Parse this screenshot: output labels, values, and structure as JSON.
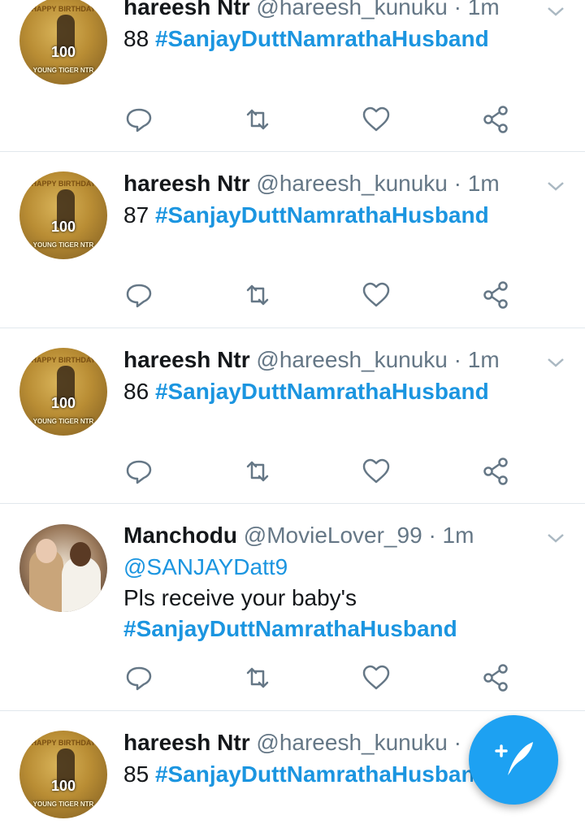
{
  "tweets": [
    {
      "name": "hareesh Ntr",
      "handle": "@hareesh_kunuku",
      "time": "· 1m",
      "number": "88",
      "hashtag": "#SanjayDuttNamrathaHusband"
    },
    {
      "name": "hareesh Ntr",
      "handle": "@hareesh_kunuku",
      "time": "· 1m",
      "number": "87",
      "hashtag": "#SanjayDuttNamrathaHusband"
    },
    {
      "name": "hareesh Ntr",
      "handle": "@hareesh_kunuku",
      "time": "· 1m",
      "number": "86",
      "hashtag": "#SanjayDuttNamrathaHusband"
    },
    {
      "name": "Manchodu",
      "handle": "@MovieLover_99",
      "time": "· 1m",
      "mention": "@SANJAYDatt9",
      "text": "Pls receive your baby's",
      "hashtag": "#SanjayDuttNamrathaHusband"
    },
    {
      "name": "hareesh Ntr",
      "handle": "@hareesh_kunuku",
      "time": "·",
      "number": "85",
      "hashtag": "#SanjayDuttNamrathaHusband"
    }
  ],
  "avatar_text": {
    "top": "HAPPY BIRTHDAY",
    "num": "100",
    "bottom": "YOUNG TIGER NTR"
  },
  "colors": {
    "link": "#1b95e0",
    "muted": "#657786",
    "fab": "#1da1f2",
    "divider": "#e1e8ed"
  },
  "icons": {
    "reply": "reply-icon",
    "retweet": "retweet-icon",
    "like": "heart-icon",
    "share": "share-icon",
    "more": "chevron-down-icon",
    "compose": "compose-tweet-icon"
  }
}
